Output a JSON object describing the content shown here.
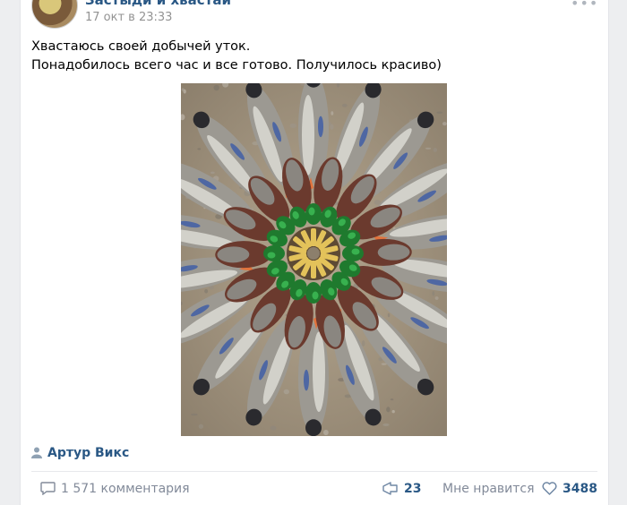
{
  "post": {
    "group_name": "Застыди и хвастай",
    "date": "17 окт в 23:33",
    "text_line1": "Хвастаюсь своей добычей уток.",
    "text_line2": "Понадобилось всего час и все готово. Получилось красиво)",
    "author": "Артур Викс"
  },
  "actions": {
    "comments": "1 571 комментария",
    "shares": "23",
    "like_label": "Мне нравится",
    "likes": "3488"
  },
  "icons": [
    "more-icon",
    "person-icon",
    "comment-icon",
    "share-icon",
    "heart-icon"
  ],
  "colors": {
    "link": "#2a5885",
    "muted": "#828a99",
    "background": "#edeef0"
  }
}
